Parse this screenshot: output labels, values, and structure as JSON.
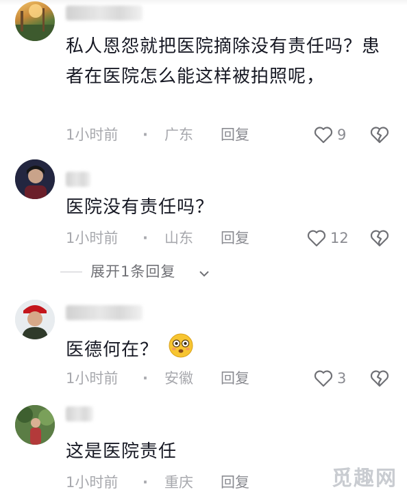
{
  "comments": [
    {
      "text": "私人恩怨就把医院摘除没有责任吗？患者在医院怎么能这样被拍照呢，",
      "time": "1小时前",
      "location": "广东",
      "reply": "回复",
      "likes": "9"
    },
    {
      "text": "医院没有责任吗？",
      "time": "1小时前",
      "location": "山东",
      "reply": "回复",
      "likes": "12"
    },
    {
      "text": "医德何在？",
      "time": "1小时前",
      "location": "安徽",
      "reply": "回复",
      "likes": "3"
    },
    {
      "text": "这是医院责任",
      "time": "1小时前",
      "location": "重庆",
      "reply": "回复",
      "likes": ""
    }
  ],
  "expand_replies": "展开1条回复",
  "separator": "·",
  "watermark": "觅趣网",
  "icons": {
    "like": "heart-outline-icon",
    "dislike": "broken-heart-icon",
    "expand": "chevron-down-icon",
    "emoji": "flushed-face-emoji-icon"
  },
  "colors": {
    "text": "#161823",
    "meta": "#a7a8ad",
    "background": "#ffffff"
  }
}
